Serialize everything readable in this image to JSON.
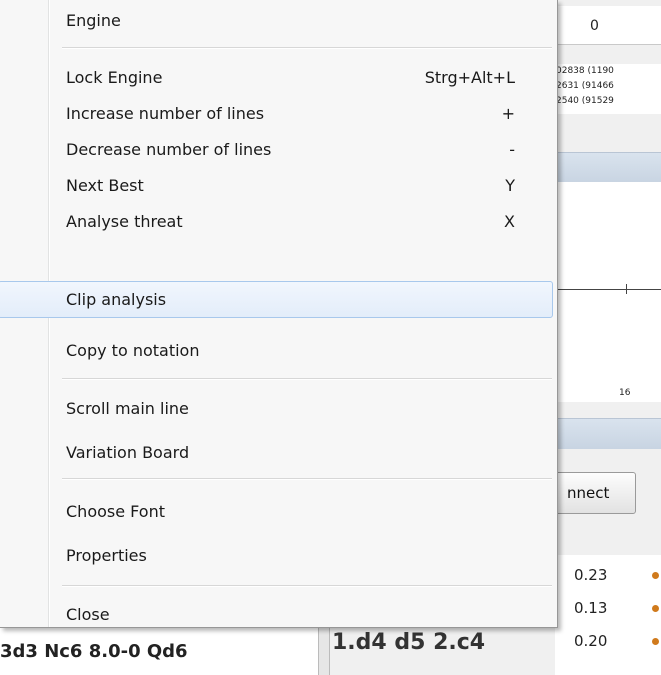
{
  "background": {
    "top_cell": "0",
    "mini_lines": [
      "02838 (1190",
      "2631 (91466",
      "2540 (91529"
    ],
    "graph_label": "16",
    "connect_label": "nnect",
    "evals": [
      "0.23",
      "0.13",
      "0.20"
    ],
    "left_text": "3d3 Nc6 8.0-0 Qd6",
    "mid_text": "1.d4 d5 2.c4",
    "colors": {
      "eval_dot": "#d07a1c",
      "highlight_border": "#a8c8ec"
    }
  },
  "menu": {
    "items": [
      {
        "label": "Engine",
        "shortcut": ""
      },
      {
        "label": "Lock Engine",
        "shortcut": "Strg+Alt+L"
      },
      {
        "label": "Increase number of lines",
        "shortcut": "+"
      },
      {
        "label": "Decrease number of lines",
        "shortcut": "-"
      },
      {
        "label": "Next Best",
        "shortcut": "Y"
      },
      {
        "label": "Analyse threat",
        "shortcut": "X"
      },
      {
        "label": "Clip analysis",
        "shortcut": ""
      },
      {
        "label": "Copy to notation",
        "shortcut": ""
      },
      {
        "label": "Scroll main line",
        "shortcut": ""
      },
      {
        "label": "Variation Board",
        "shortcut": ""
      },
      {
        "label": "Choose Font",
        "shortcut": ""
      },
      {
        "label": "Properties",
        "shortcut": ""
      },
      {
        "label": "Close",
        "shortcut": ""
      }
    ],
    "highlighted": "Clip analysis"
  }
}
